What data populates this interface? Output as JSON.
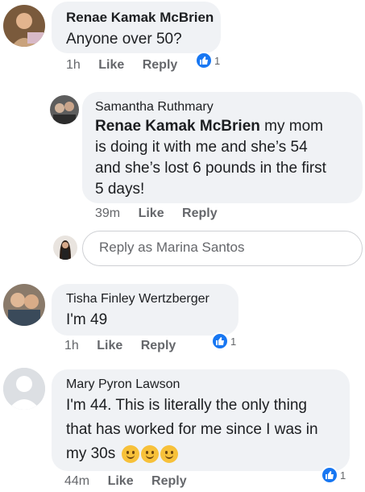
{
  "comments": [
    {
      "author": "Renae Kamak McBrien",
      "text": "Anyone over 50?",
      "time": "1h",
      "like_label": "Like",
      "reply_label": "Reply",
      "reaction_count": "1"
    },
    {
      "author": "Samantha Ruthmary",
      "mention": "Renae Kamak McBrien",
      "text_line1_rest": " my mom",
      "text_line2": "is doing it with me and she’s 54",
      "text_line3": "and she’s lost 6 pounds in the first",
      "text_line4": "5 days!",
      "time": "39m",
      "like_label": "Like",
      "reply_label": "Reply"
    },
    {
      "author": "Tisha Finley Wertzberger",
      "text": "I'm 49",
      "time": "1h",
      "like_label": "Like",
      "reply_label": "Reply",
      "reaction_count": "1"
    },
    {
      "author": "Mary Pyron Lawson",
      "text_line1": "I'm 44. This is literally the only thing",
      "text_line2": "that has worked for me since I was in",
      "text_line3": "my 30s",
      "time": "44m",
      "like_label": "Like",
      "reply_label": "Reply",
      "reaction_count": "1"
    }
  ],
  "reply_box": {
    "placeholder": "Reply as Marina Santos"
  },
  "colors": {
    "bubble": "#f0f2f5",
    "like_blue": "#1877f2",
    "meta_gray": "#65676b"
  }
}
